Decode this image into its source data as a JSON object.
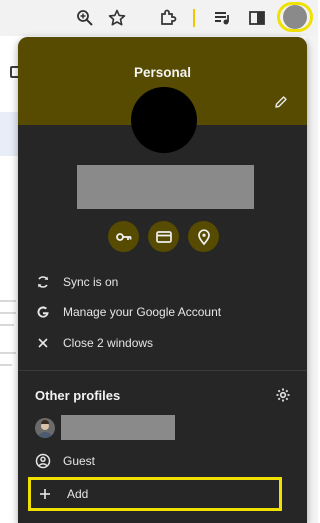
{
  "toolbar": {
    "icons": [
      "zoom-icon",
      "bookmark-star-icon",
      "extensions-icon",
      "reading-list-icon",
      "side-panel-icon",
      "profile-avatar-icon"
    ]
  },
  "profile_menu": {
    "profile_name": "Personal",
    "quick_actions": [
      "key-icon",
      "credit-card-icon",
      "location-pin-icon"
    ],
    "menu_items": [
      {
        "label": "Sync is on",
        "icon": "sync-icon"
      },
      {
        "label": "Manage your Google Account",
        "icon": "google-icon"
      },
      {
        "label": "Close 2 windows",
        "icon": "close-icon"
      }
    ],
    "other_profiles_header": "Other profiles",
    "guest_label": "Guest",
    "add_label": "Add"
  },
  "colors": {
    "banner": "#564b00",
    "popup_bg": "#262626",
    "highlight": "#f0e100",
    "redaction": "#8a8a8a"
  }
}
